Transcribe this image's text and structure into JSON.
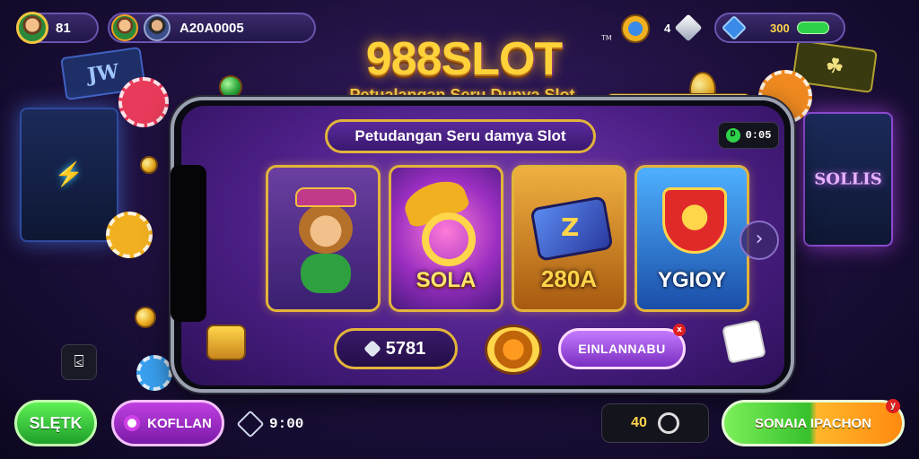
{
  "top_bar": {
    "player_level": "81",
    "player_id": "A20A0005",
    "top_right_count": "4",
    "balance": "300"
  },
  "header": {
    "title": "988SLOT",
    "trademark": "TM",
    "tagline": "Petualangan Seru Dunya Slot"
  },
  "screen": {
    "banner": "Petudangan Seru damya Slot",
    "online_status": "0:05",
    "online_icon": "D",
    "games": [
      {
        "label": ""
      },
      {
        "label": "SOLA"
      },
      {
        "label": "280A"
      },
      {
        "label": "YGIOY"
      }
    ],
    "gem_value": "5781",
    "cta_label": "EINLANNABU",
    "cta_badge": "x"
  },
  "footer": {
    "left_button": "SLĘTK",
    "purple_button": "KOFLLAN",
    "timer": "9:00",
    "counter": "40",
    "big_button": "SONAIA IPACHON",
    "big_button_badge": "y"
  },
  "icons": {
    "next": "chevron-right-icon",
    "back": "back-icon",
    "gem": "diamond-icon",
    "online": "online-icon"
  },
  "colors": {
    "gold": "#ffd23a",
    "purple": "#7b3fb8",
    "green": "#36c02c",
    "orange": "#ff8a10"
  }
}
